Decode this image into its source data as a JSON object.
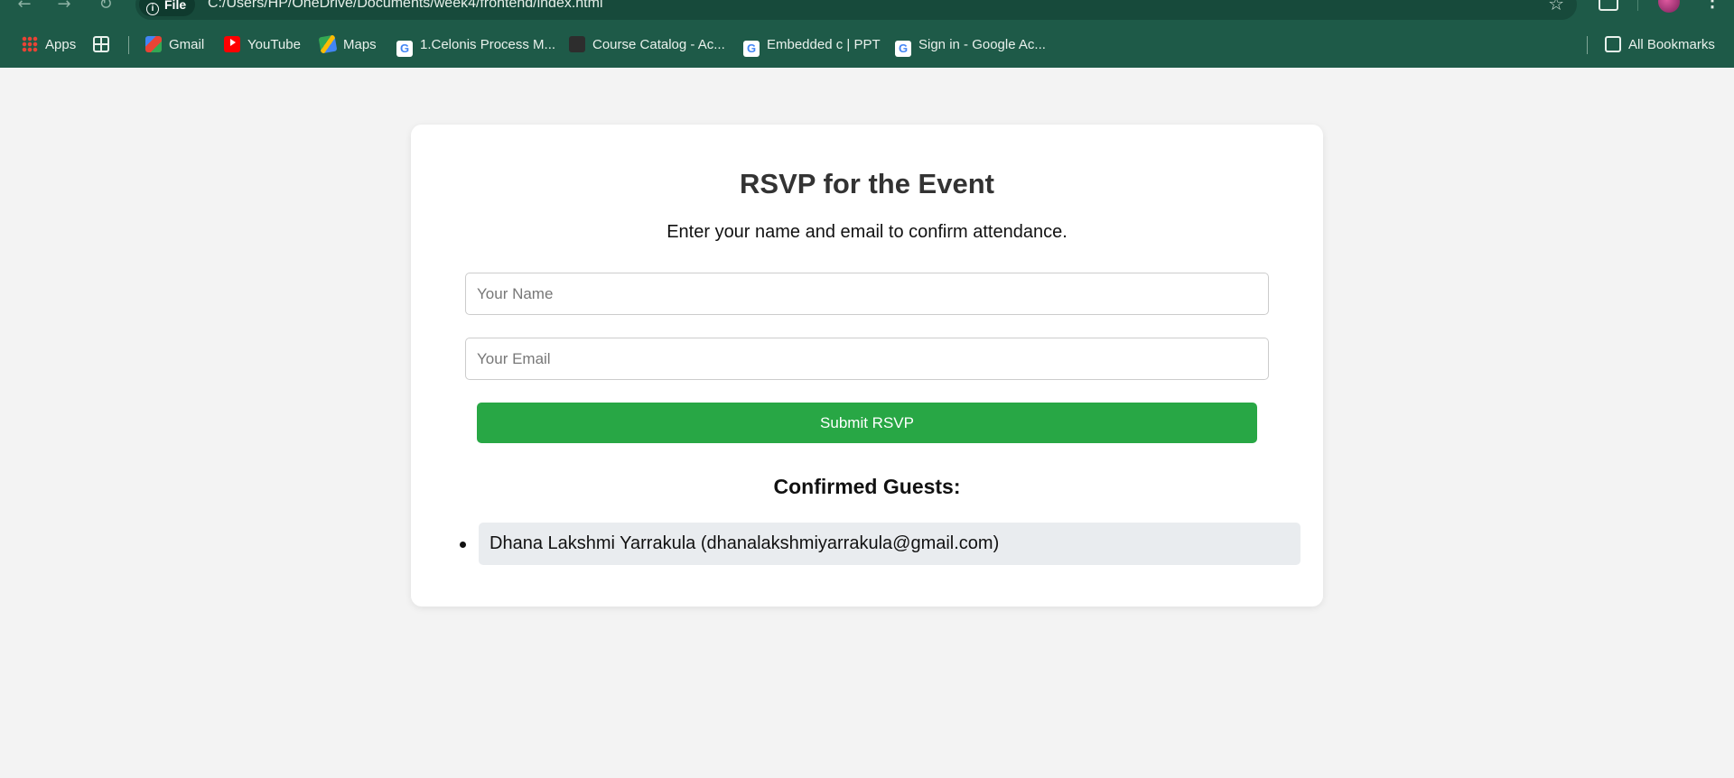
{
  "browser": {
    "site_chip": "File",
    "url": "C:/Users/HP/OneDrive/Documents/week4/frontend/index.html",
    "bookmarks": [
      {
        "label": "Apps",
        "icon": "apps-icon"
      },
      {
        "label": "Gmail",
        "icon": "gmail-icon"
      },
      {
        "label": "YouTube",
        "icon": "youtube-icon"
      },
      {
        "label": "Maps",
        "icon": "maps-icon"
      },
      {
        "label": "1.Celonis Process M...",
        "icon": "google-icon"
      },
      {
        "label": "Course Catalog - Ac...",
        "icon": "graduation-cap-icon"
      },
      {
        "label": "Embedded c | PPT",
        "icon": "google-icon"
      },
      {
        "label": "Sign in - Google Ac...",
        "icon": "google-icon"
      }
    ],
    "all_bookmarks": "All Bookmarks"
  },
  "page": {
    "title": "RSVP for the Event",
    "subtitle": "Enter your name and email to confirm attendance.",
    "name_placeholder": "Your Name",
    "email_placeholder": "Your Email",
    "submit_label": "Submit RSVP",
    "guests_heading": "Confirmed Guests:",
    "guests": [
      "Dhana Lakshmi Yarrakula (dhanalakshmiyarrakula@gmail.com)"
    ]
  },
  "colors": {
    "chrome": "#1e5a48",
    "background": "#f3f3f3",
    "submit": "#28a745",
    "guest_item": "#e9ecef"
  }
}
